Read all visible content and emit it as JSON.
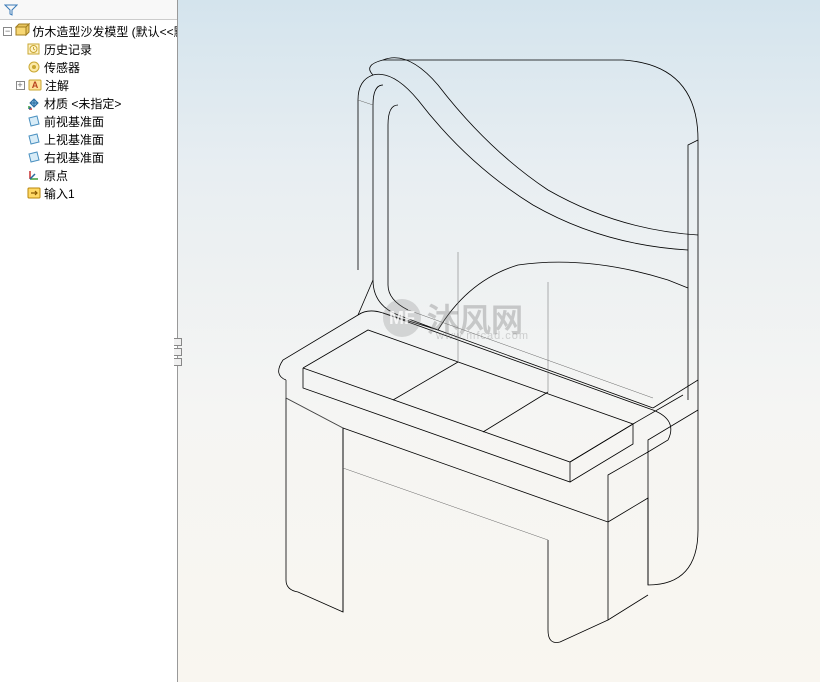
{
  "tree": {
    "root": {
      "label": "仿木造型沙发模型  (默认<<默"
    },
    "items": [
      {
        "label": "历史记录",
        "icon": "history-icon"
      },
      {
        "label": "传感器",
        "icon": "sensor-icon"
      },
      {
        "label": "注解",
        "icon": "annotation-icon",
        "expandable": true
      },
      {
        "label": "材质 <未指定>",
        "icon": "material-icon"
      },
      {
        "label": "前视基准面",
        "icon": "plane-icon"
      },
      {
        "label": "上视基准面",
        "icon": "plane-icon"
      },
      {
        "label": "右视基准面",
        "icon": "plane-icon"
      },
      {
        "label": "原点",
        "icon": "origin-icon"
      },
      {
        "label": "输入1",
        "icon": "import-icon"
      }
    ]
  },
  "watermark": {
    "text": "沐风网",
    "logo_text": "MF",
    "url": "www.mfcad.com"
  }
}
